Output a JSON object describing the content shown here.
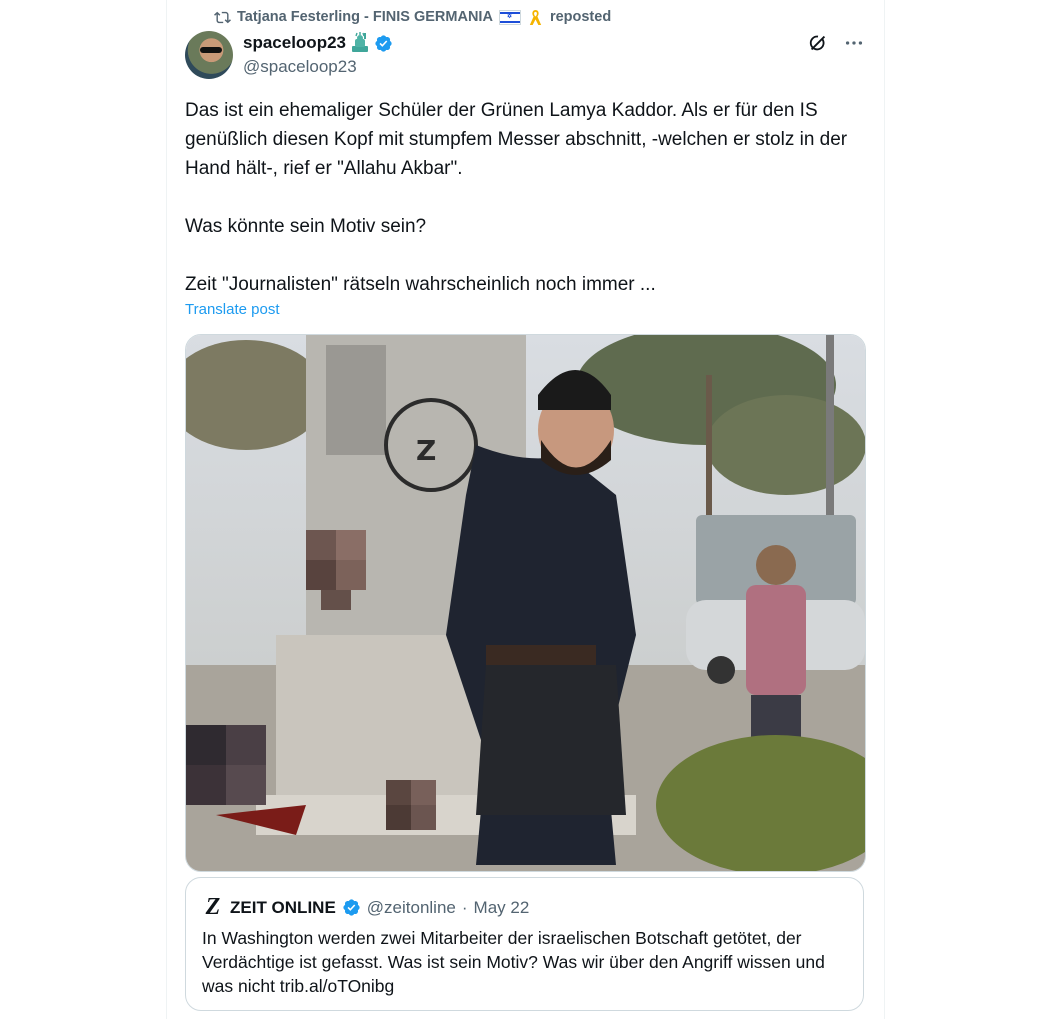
{
  "repost": {
    "user": "Tatjana Festerling - FINIS GERMANIA",
    "action": "reposted"
  },
  "author": {
    "name": "spaceloop23",
    "handle": "@spaceloop23"
  },
  "post": {
    "paragraphs": [
      "Das ist ein ehemaliger Schüler der Grünen Lamya Kaddor. Als er für den IS genüßlich diesen Kopf mit stumpfem Messer abschnitt, -welchen er stolz in der Hand hält-, rief er \"Allahu Akbar\".",
      "Was könnte sein Motiv sein?",
      "Zeit \"Journalisten\" rätseln wahrscheinlich noch immer ..."
    ],
    "translate_label": "Translate post"
  },
  "quote": {
    "name": "ZEIT ONLINE",
    "handle": "@zeitonline",
    "separator": "·",
    "date": "May 22",
    "text": "In Washington werden zwei Mitarbeiter der israelischen Botschaft getötet, der Verdächtige ist gefasst. Was ist sein Motiv? Was wir über den Angriff wissen und was nicht trib.al/oTOnibg"
  },
  "colors": {
    "accent": "#1d9bf0",
    "secondary_text": "#536471",
    "border": "#cfd9de"
  },
  "icons": [
    "repost-icon",
    "israel-flag-icon",
    "yellow-ribbon-icon",
    "statue-of-liberty-icon",
    "verified-badge-icon",
    "grok-icon",
    "more-icon",
    "zeit-logo-icon"
  ]
}
